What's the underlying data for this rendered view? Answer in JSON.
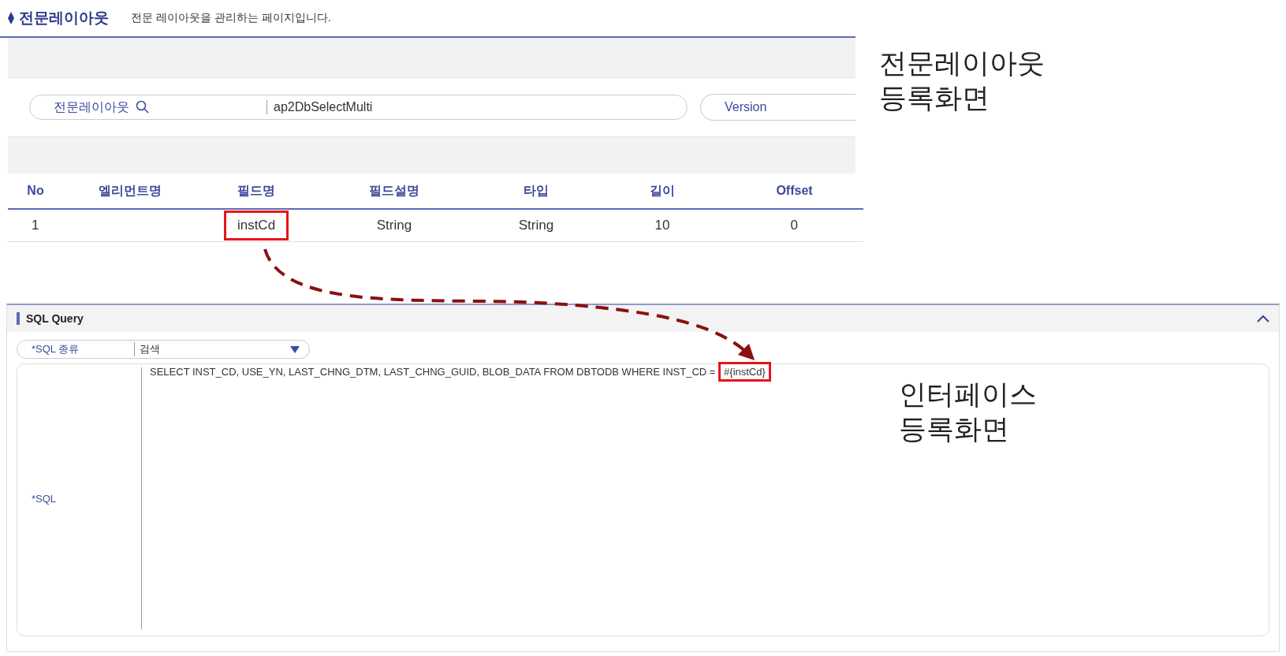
{
  "layout_screen": {
    "title": "전문레이아웃",
    "description": "전문 레이아웃을 관리하는 페이지입니다.",
    "search": {
      "label": "전문레이아웃",
      "value": "ap2DbSelectMulti"
    },
    "version_field": {
      "label": "Version"
    },
    "table": {
      "columns": [
        "No",
        "엘리먼트명",
        "필드명",
        "필드설명",
        "타입",
        "길이",
        "Offset"
      ],
      "rows": [
        {
          "no": {
            "text": "1",
            "highlighted": false
          },
          "field_name": {
            "text": "instCd",
            "highlighted": true
          },
          "field_description": {
            "text": "String",
            "highlighted": false
          },
          "type": {
            "text": "String",
            "highlighted": false
          },
          "length": {
            "text": "10",
            "highlighted": false
          },
          "offset": {
            "text": "0",
            "highlighted": false
          }
        }
      ]
    }
  },
  "layout_caption": [
    "전문레이아웃",
    "등록화면"
  ],
  "sql_panel": {
    "title": "SQL Query",
    "expanded": true,
    "sql_type": {
      "label": "*SQL 종류",
      "value": "검색"
    },
    "sql": {
      "label": "*SQL",
      "text": "SELECT INST_CD, USE_YN, LAST_CHNG_DTM, LAST_CHNG_GUID, BLOB_DATA FROM DBTODB WHERE INST_CD = ",
      "param": "#{instCd}",
      "param_highlighted": true
    }
  },
  "interface_caption": [
    "인터페이스",
    "등록화면"
  ]
}
